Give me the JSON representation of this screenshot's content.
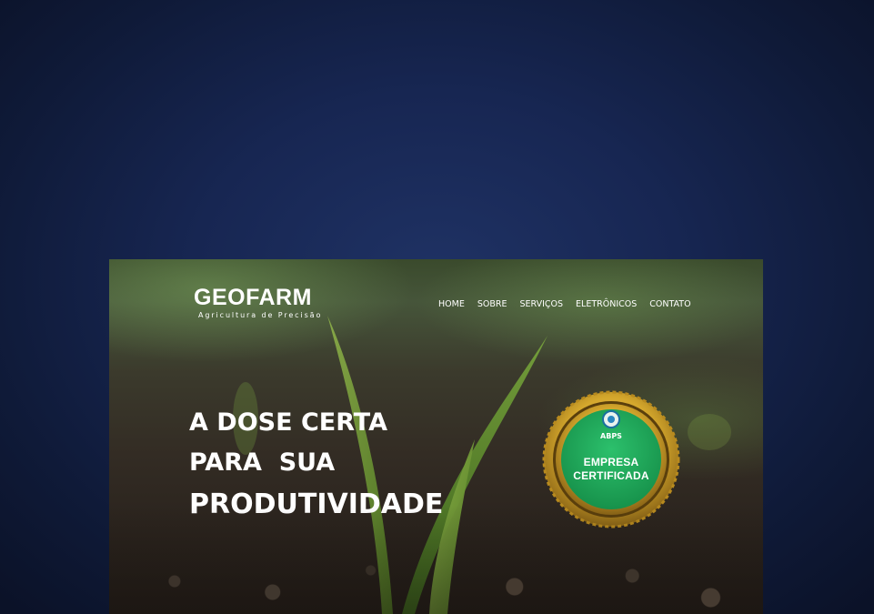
{
  "site": {
    "logo_word": "GEOFARM",
    "logo_tagline": "Agricultura de Precisão"
  },
  "nav": {
    "items": [
      {
        "label": "HOME"
      },
      {
        "label": "SOBRE"
      },
      {
        "label": "SERVIÇOS"
      },
      {
        "label": "ELETRÔNICOS"
      },
      {
        "label": "CONTATO"
      }
    ]
  },
  "hero": {
    "line1": "A DOSE CERTA",
    "line2": "PARA  SUA",
    "line3": "PRODUTIVIDADE"
  },
  "seal": {
    "abbr": "ABPS",
    "line1": "EMPRESA",
    "line2": "CERTIFICADA",
    "colors": {
      "gold": "#d4a72c",
      "green": "#1fa85a"
    }
  }
}
